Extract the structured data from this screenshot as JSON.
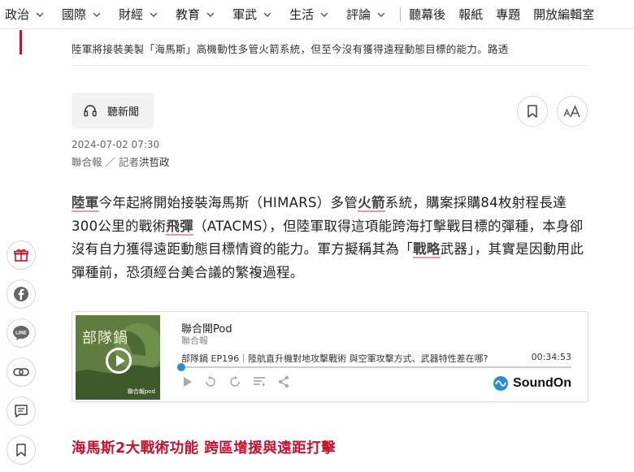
{
  "nav": {
    "items": [
      {
        "label": "政治"
      },
      {
        "label": "國際"
      },
      {
        "label": "財經"
      },
      {
        "label": "教育"
      },
      {
        "label": "軍武"
      },
      {
        "label": "生活"
      },
      {
        "label": "評論"
      }
    ],
    "links": [
      {
        "label": "聽幕後"
      },
      {
        "label": "報紙"
      },
      {
        "label": "專題"
      },
      {
        "label": "開放編輯室"
      }
    ]
  },
  "photo_caption": "陸軍將接裝美製「海馬斯」高機動性多管火箭系統，但至今沒有獲得遠程動態目標的能力。路透",
  "listen": {
    "label": "聽新聞"
  },
  "meta": {
    "datetime": "2024-07-02 07:30",
    "source": "聯合報 ／ 記者",
    "author": "洪哲政"
  },
  "article": {
    "segments": [
      {
        "text": "陸軍",
        "kw": true
      },
      {
        "text": "今年起將開始接裝海馬斯（HIMARS）多管"
      },
      {
        "text": "火箭",
        "kw": true
      },
      {
        "text": "系統，購案採購84枚射程長達300公里的戰術"
      },
      {
        "text": "飛彈",
        "kw": true
      },
      {
        "text": "（ATACMS），但陸軍取得這項能跨海打擊戰目標的彈種，本身卻沒有自力獲得遠距動態目標情資的能力。軍方擬稱其為「"
      },
      {
        "text": "戰略",
        "kw": true
      },
      {
        "text": "武器」，其實是因動用此彈種前，恐須經台美合議的繁複過程。"
      }
    ]
  },
  "podcast": {
    "cover_title": "部隊鍋",
    "cover_brand": "聯合報pod",
    "title": "聯合開Pod",
    "author": "聯合報",
    "episode": "部隊鍋 EP196｜陸航直升機對地攻擊戰術 與空軍攻擊方式、武器特性差在哪?",
    "duration": "00:34:53",
    "progress": 0,
    "brand": "SoundOn"
  },
  "section_heading": "海馬斯2大戰術功能 跨區增援與遠距打擊",
  "colors": {
    "accent_red": "#c8102e",
    "player_blue": "#2d8ccf"
  },
  "side_icons": [
    "gift-icon",
    "facebook-icon",
    "line-icon",
    "link-icon",
    "comment-icon",
    "bookmark-icon"
  ]
}
